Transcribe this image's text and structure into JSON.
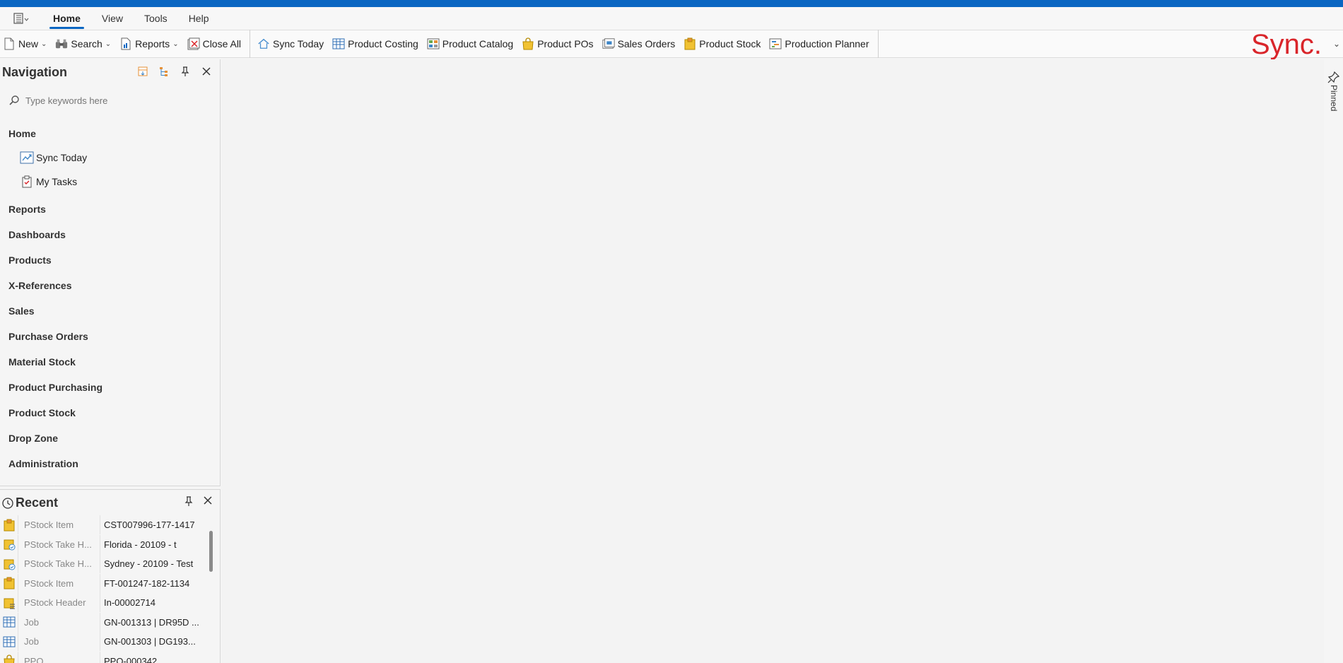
{
  "menubar": {
    "tabs": [
      {
        "label": "Home",
        "active": true
      },
      {
        "label": "View",
        "active": false
      },
      {
        "label": "Tools",
        "active": false
      },
      {
        "label": "Help",
        "active": false
      }
    ]
  },
  "toolbar": {
    "new_label": "New",
    "search_label": "Search",
    "reports_label": "Reports",
    "close_all_label": "Close All",
    "sync_today_label": "Sync Today",
    "product_costing_label": "Product Costing",
    "product_catalog_label": "Product Catalog",
    "product_pos_label": "Product POs",
    "sales_orders_label": "Sales Orders",
    "product_stock_label": "Product Stock",
    "production_planner_label": "Production Planner"
  },
  "brand": {
    "logo_text": "Sync.",
    "color": "#d9252a"
  },
  "colors": {
    "accent": "#0a66c2"
  },
  "navigation": {
    "title": "Navigation",
    "search_placeholder": "Type keywords here",
    "home_label": "Home",
    "home_items": [
      {
        "label": "Sync Today",
        "icon": "chart-icon"
      },
      {
        "label": "My Tasks",
        "icon": "clipboard-check-icon"
      }
    ],
    "sections": [
      "Reports",
      "Dashboards",
      "Products",
      "X-References",
      "Sales",
      "Purchase Orders",
      "Material Stock",
      "Product Purchasing",
      "Product Stock",
      "Drop Zone",
      "Administration"
    ]
  },
  "recent": {
    "title": "Recent",
    "rows": [
      {
        "type": "PStock Item",
        "value": "CST007996-177-1417",
        "icon": "stock-item-icon"
      },
      {
        "type": "PStock Take H...",
        "value": "Florida - 20109 - t",
        "icon": "stock-take-icon"
      },
      {
        "type": "PStock Take H...",
        "value": "Sydney - 20109 - Test",
        "icon": "stock-take-icon"
      },
      {
        "type": "PStock Item",
        "value": "FT-001247-182-1134",
        "icon": "stock-item-icon"
      },
      {
        "type": "PStock Header",
        "value": "In-00002714",
        "icon": "stock-header-icon"
      },
      {
        "type": "Job",
        "value": "GN-001313 | DR95D ...",
        "icon": "grid-icon"
      },
      {
        "type": "Job",
        "value": "GN-001303 | DG193...",
        "icon": "grid-icon"
      },
      {
        "type": "PPO",
        "value": "PPO-000342",
        "icon": "bag-icon"
      }
    ]
  },
  "right_panel": {
    "pinned_label": "Pinned"
  }
}
